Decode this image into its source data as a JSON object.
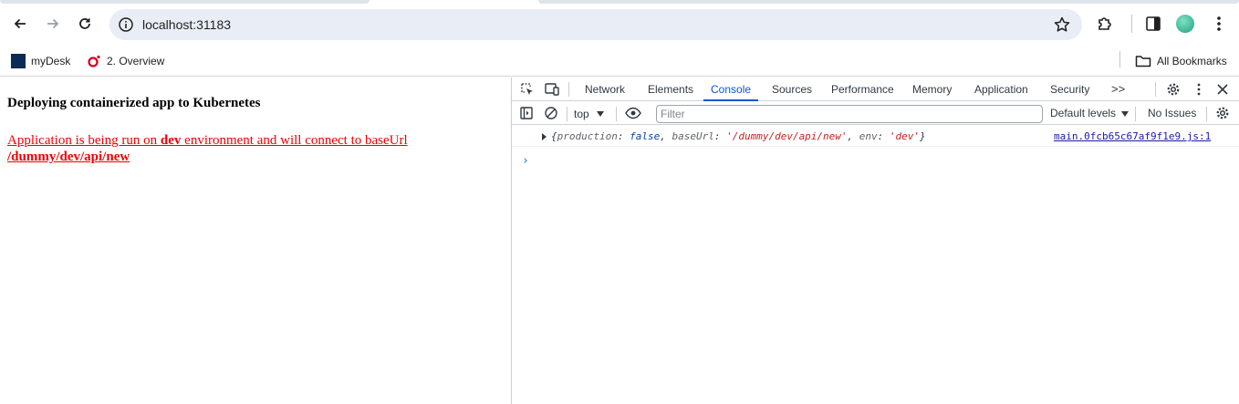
{
  "browser": {
    "address": {
      "url": "localhost:31183"
    },
    "bookmarks": [
      {
        "label": "myDesk",
        "icon": "morgan-stanley-logo"
      },
      {
        "label": "2. Overview",
        "icon": "red-ring-icon"
      }
    ],
    "all_bookmarks_label": "All Bookmarks"
  },
  "page": {
    "heading": "Deploying containerized app to Kubernetes",
    "message_prefix": "Application is being run on ",
    "message_env": "dev",
    "message_middle": " environment and will connect to baseUrl ",
    "message_url": "/dummy/dev/api/new",
    "message_color": "#ee0000"
  },
  "devtools": {
    "tabs": [
      "Network",
      "Elements",
      "Console",
      "Sources",
      "Performance",
      "Memory",
      "Application",
      "Security"
    ],
    "active_tab": "Console",
    "more_tabs_label": ">>",
    "context": "top",
    "filter_placeholder": "Filter",
    "levels_label": "Default levels",
    "issues_label": "No Issues",
    "console": {
      "open_brace": "{",
      "k1": "production",
      "v1": "false",
      "k2": "baseUrl",
      "v2": "'/dummy/dev/api/new'",
      "k3": "env",
      "v3": "'dev'",
      "close_brace": "}",
      "source": "main.0fcb65c67af9f1e9.js:1"
    },
    "prompt": "›",
    "accent": "#0b57d0"
  }
}
